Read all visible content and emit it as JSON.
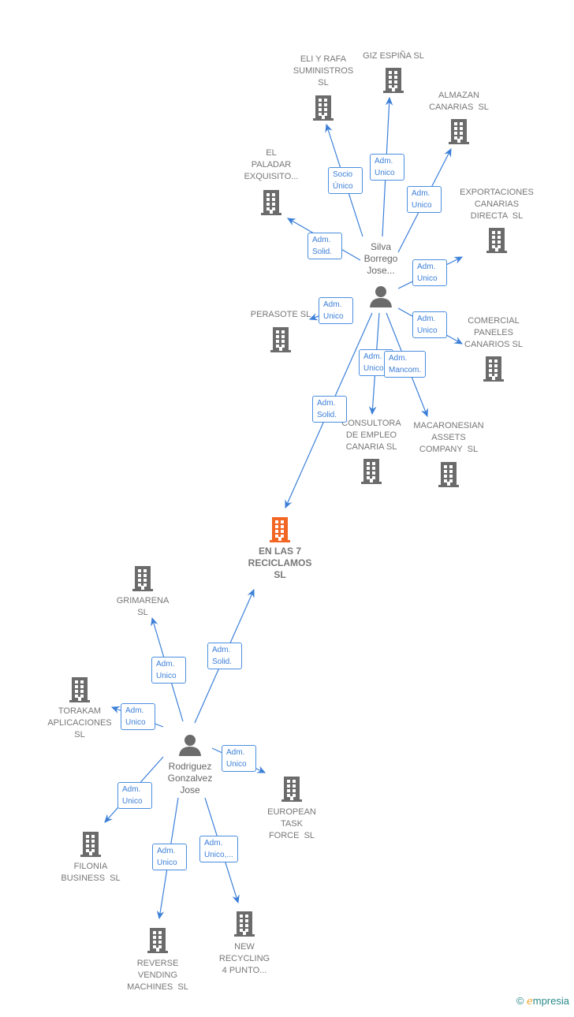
{
  "focus_color": "#f26522",
  "node_color": "#6b6b6b",
  "edge_color": "#3b7fd8",
  "companies": [
    {
      "id": "eli",
      "label": "ELI Y RAFA\nSUMINISTROS\nSL"
    },
    {
      "id": "giz",
      "label": "GIZ ESPIÑA SL"
    },
    {
      "id": "almazan",
      "label": "ALMAZAN\nCANARIAS  SL"
    },
    {
      "id": "paladar",
      "label": "EL\nPALADAR\nEXQUISITO..."
    },
    {
      "id": "export",
      "label": "EXPORTACIONES\nCANARIAS\nDIRECTA  SL"
    },
    {
      "id": "perasote",
      "label": "PERASOTE SL"
    },
    {
      "id": "comercial",
      "label": "COMERCIAL\nPANELES\nCANARIOS SL"
    },
    {
      "id": "consultora",
      "label": "CONSULTORA\nDE EMPLEO\nCANARIA SL"
    },
    {
      "id": "macaronesian",
      "label": "MACARONESIAN\nASSETS\nCOMPANY  SL"
    },
    {
      "id": "enlas7",
      "label": "EN LAS 7\nRECICLAMOS\nSL",
      "focus": true
    },
    {
      "id": "grimarena",
      "label": "GRIMARENA\nSL"
    },
    {
      "id": "torakam",
      "label": "TORAKAM\nAPLICACIONES\nSL"
    },
    {
      "id": "european",
      "label": "EUROPEAN\nTASK\nFORCE  SL"
    },
    {
      "id": "filonia",
      "label": "FILONIA\nBUSINESS  SL"
    },
    {
      "id": "reverse",
      "label": "REVERSE\nVENDING\nMACHINES  SL"
    },
    {
      "id": "newrec",
      "label": "NEW\nRECYCLING\n4 PUNTO..."
    }
  ],
  "persons": [
    {
      "id": "silva",
      "label": "Silva\nBorrego\nJose..."
    },
    {
      "id": "rodriguez",
      "label": "Rodriguez\nGonzalvez\nJose"
    }
  ],
  "relations": [
    {
      "from": "silva",
      "to": "eli",
      "role": "Socio\nÚnico"
    },
    {
      "from": "silva",
      "to": "giz",
      "role": "Adm.\nUnico"
    },
    {
      "from": "silva",
      "to": "almazan",
      "role": "Adm.\nUnico"
    },
    {
      "from": "silva",
      "to": "paladar",
      "role": "Adm.\nSolid."
    },
    {
      "from": "silva",
      "to": "export",
      "role": "Adm.\nUnico"
    },
    {
      "from": "silva",
      "to": "perasote",
      "role": "Adm.\nUnico"
    },
    {
      "from": "silva",
      "to": "comercial",
      "role": "Adm.\nUnico"
    },
    {
      "from": "silva",
      "to": "consultora",
      "role": "Adm.\nUnico"
    },
    {
      "from": "silva",
      "to": "macaronesian",
      "role": "Adm.\nMancom."
    },
    {
      "from": "silva",
      "to": "enlas7",
      "role": "Adm.\nSolid."
    },
    {
      "from": "rodriguez",
      "to": "grimarena",
      "role": "Adm.\nUnico"
    },
    {
      "from": "rodriguez",
      "to": "enlas7",
      "role": "Adm.\nSolid."
    },
    {
      "from": "rodriguez",
      "to": "torakam",
      "role": "Adm.\nUnico"
    },
    {
      "from": "rodriguez",
      "to": "european",
      "role": "Adm.\nUnico"
    },
    {
      "from": "rodriguez",
      "to": "filonia",
      "role": "Adm.\nUnico"
    },
    {
      "from": "rodriguez",
      "to": "reverse",
      "role": "Adm.\nUnico"
    },
    {
      "from": "rodriguez",
      "to": "newrec",
      "role": "Adm.\nUnico,..."
    }
  ],
  "footer": {
    "copyright": "©",
    "brand_first": "e",
    "brand_rest": "mpresia"
  }
}
